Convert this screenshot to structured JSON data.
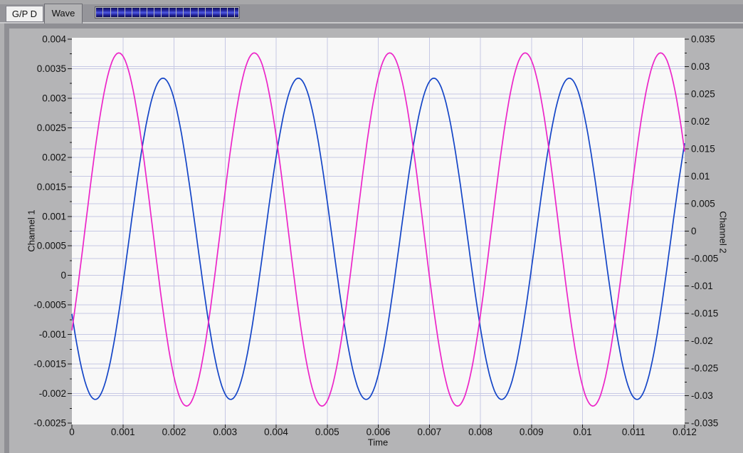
{
  "window": {
    "background_color": "#b0b0b2",
    "body_color": "#b4b4b6",
    "frame_shadow_color": "#8f8f94"
  },
  "tab_bar": {
    "tabs": [
      {
        "label": "G/P D",
        "active": false
      },
      {
        "label": "Wave",
        "active": true
      }
    ],
    "progress_indicator": {
      "filled_segments": 19,
      "has_partial_end_segment": true,
      "segment_color": "#2a2ab0",
      "track_color": "#b9b9bb"
    }
  },
  "chart_data": {
    "type": "line",
    "title": "",
    "plot_background": "#f8f8f8",
    "grid": {
      "show": true,
      "color": "#c6c8e4"
    },
    "x_axis": {
      "label": "Time",
      "range": [
        0,
        0.012
      ],
      "tick_labels": [
        "0",
        "0.001",
        "0.002",
        "0.003",
        "0.004",
        "0.005",
        "0.006",
        "0.007",
        "0.008",
        "0.009",
        "0.01",
        "0.011",
        "0.012"
      ]
    },
    "y_axis_left": {
      "label": "Channel 1",
      "range": [
        -0.0025,
        0.004
      ],
      "tick_labels": [
        "0.004",
        "0.0035",
        "0.003",
        "0.0025",
        "0.002",
        "0.0015",
        "0.001",
        "0.0005",
        "0",
        "-0.0005",
        "-0.001",
        "-0.0015",
        "-0.002",
        "-0.0025"
      ]
    },
    "y_axis_right": {
      "label": "Channel 2",
      "range": [
        -0.035,
        0.035
      ],
      "tick_labels": [
        "0.035",
        "0.03",
        "0.025",
        "0.02",
        "0.015",
        "0.01",
        "0.005",
        "0",
        "-0.005",
        "-0.01",
        "-0.015",
        "-0.02",
        "-0.025",
        "-0.03",
        "-0.035"
      ]
    },
    "series": [
      {
        "name": "Channel 1",
        "axis": "left",
        "color": "#1445c7",
        "waveform": "sine",
        "amplitude": 0.00272,
        "offset": 0.00062,
        "frequency_hz": 377,
        "phase_rad": -2.6551
      },
      {
        "name": "Channel 2",
        "axis": "right",
        "color": "#ec25c8",
        "waveform": "sine",
        "amplitude": 0.0322,
        "offset": 0.0003,
        "frequency_hz": 377,
        "phase_rad": -0.6083
      }
    ]
  }
}
